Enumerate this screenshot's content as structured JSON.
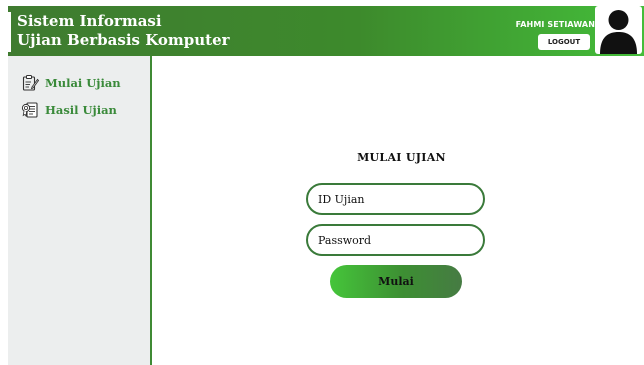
{
  "header": {
    "title_line1": "Sistem Informasi",
    "title_line2": "Ujian Berbasis Komputer",
    "user_name": "FAHMI SETIAWAN",
    "logout_label": "LOGOUT",
    "avatar_icon": "user-silhouette-icon"
  },
  "sidebar": {
    "items": [
      {
        "label": "Mulai Ujian",
        "icon": "exam-clipboard-icon"
      },
      {
        "label": "Hasil Ujian",
        "icon": "results-document-icon"
      }
    ]
  },
  "form": {
    "title": "MULAI UJIAN",
    "id_placeholder": "ID Ujian",
    "password_placeholder": "Password",
    "submit_label": "Mulai"
  },
  "colors": {
    "accent": "#3d8a2c",
    "accent_light": "#44bd3a",
    "sidebar_bg": "#eceeee",
    "text_green": "#3a8a3a"
  }
}
